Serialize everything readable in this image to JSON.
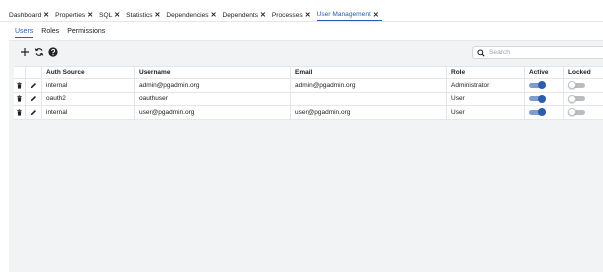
{
  "tabs": [
    {
      "label": "Dashboard",
      "active": false
    },
    {
      "label": "Properties",
      "active": false
    },
    {
      "label": "SQL",
      "active": false
    },
    {
      "label": "Statistics",
      "active": false
    },
    {
      "label": "Dependencies",
      "active": false
    },
    {
      "label": "Dependents",
      "active": false
    },
    {
      "label": "Processes",
      "active": false
    },
    {
      "label": "User Management",
      "active": true
    }
  ],
  "subtabs": [
    {
      "label": "Users",
      "active": true
    },
    {
      "label": "Roles",
      "active": false
    },
    {
      "label": "Permissions",
      "active": false
    }
  ],
  "toolbar": {
    "add_icon": "plus-icon",
    "refresh_icon": "refresh-icon",
    "help_icon": "help-icon",
    "search_placeholder": "Search"
  },
  "table": {
    "columns": [
      "Auth Source",
      "Username",
      "Email",
      "Role",
      "Active",
      "Locked"
    ],
    "rows": [
      {
        "auth_source": "internal",
        "username": "admin@pgadmin.org",
        "email": "admin@pgadmin.org",
        "role": "Administrator",
        "active": true,
        "locked": false
      },
      {
        "auth_source": "oauth2",
        "username": "oauthuser",
        "email": "",
        "role": "User",
        "active": true,
        "locked": false
      },
      {
        "auth_source": "internal",
        "username": "user@pgadmin.org",
        "email": "user@pgadmin.org",
        "role": "User",
        "active": true,
        "locked": false
      }
    ]
  },
  "colors": {
    "accent": "#2b5cad",
    "panel_bg": "#f2f3f5"
  }
}
